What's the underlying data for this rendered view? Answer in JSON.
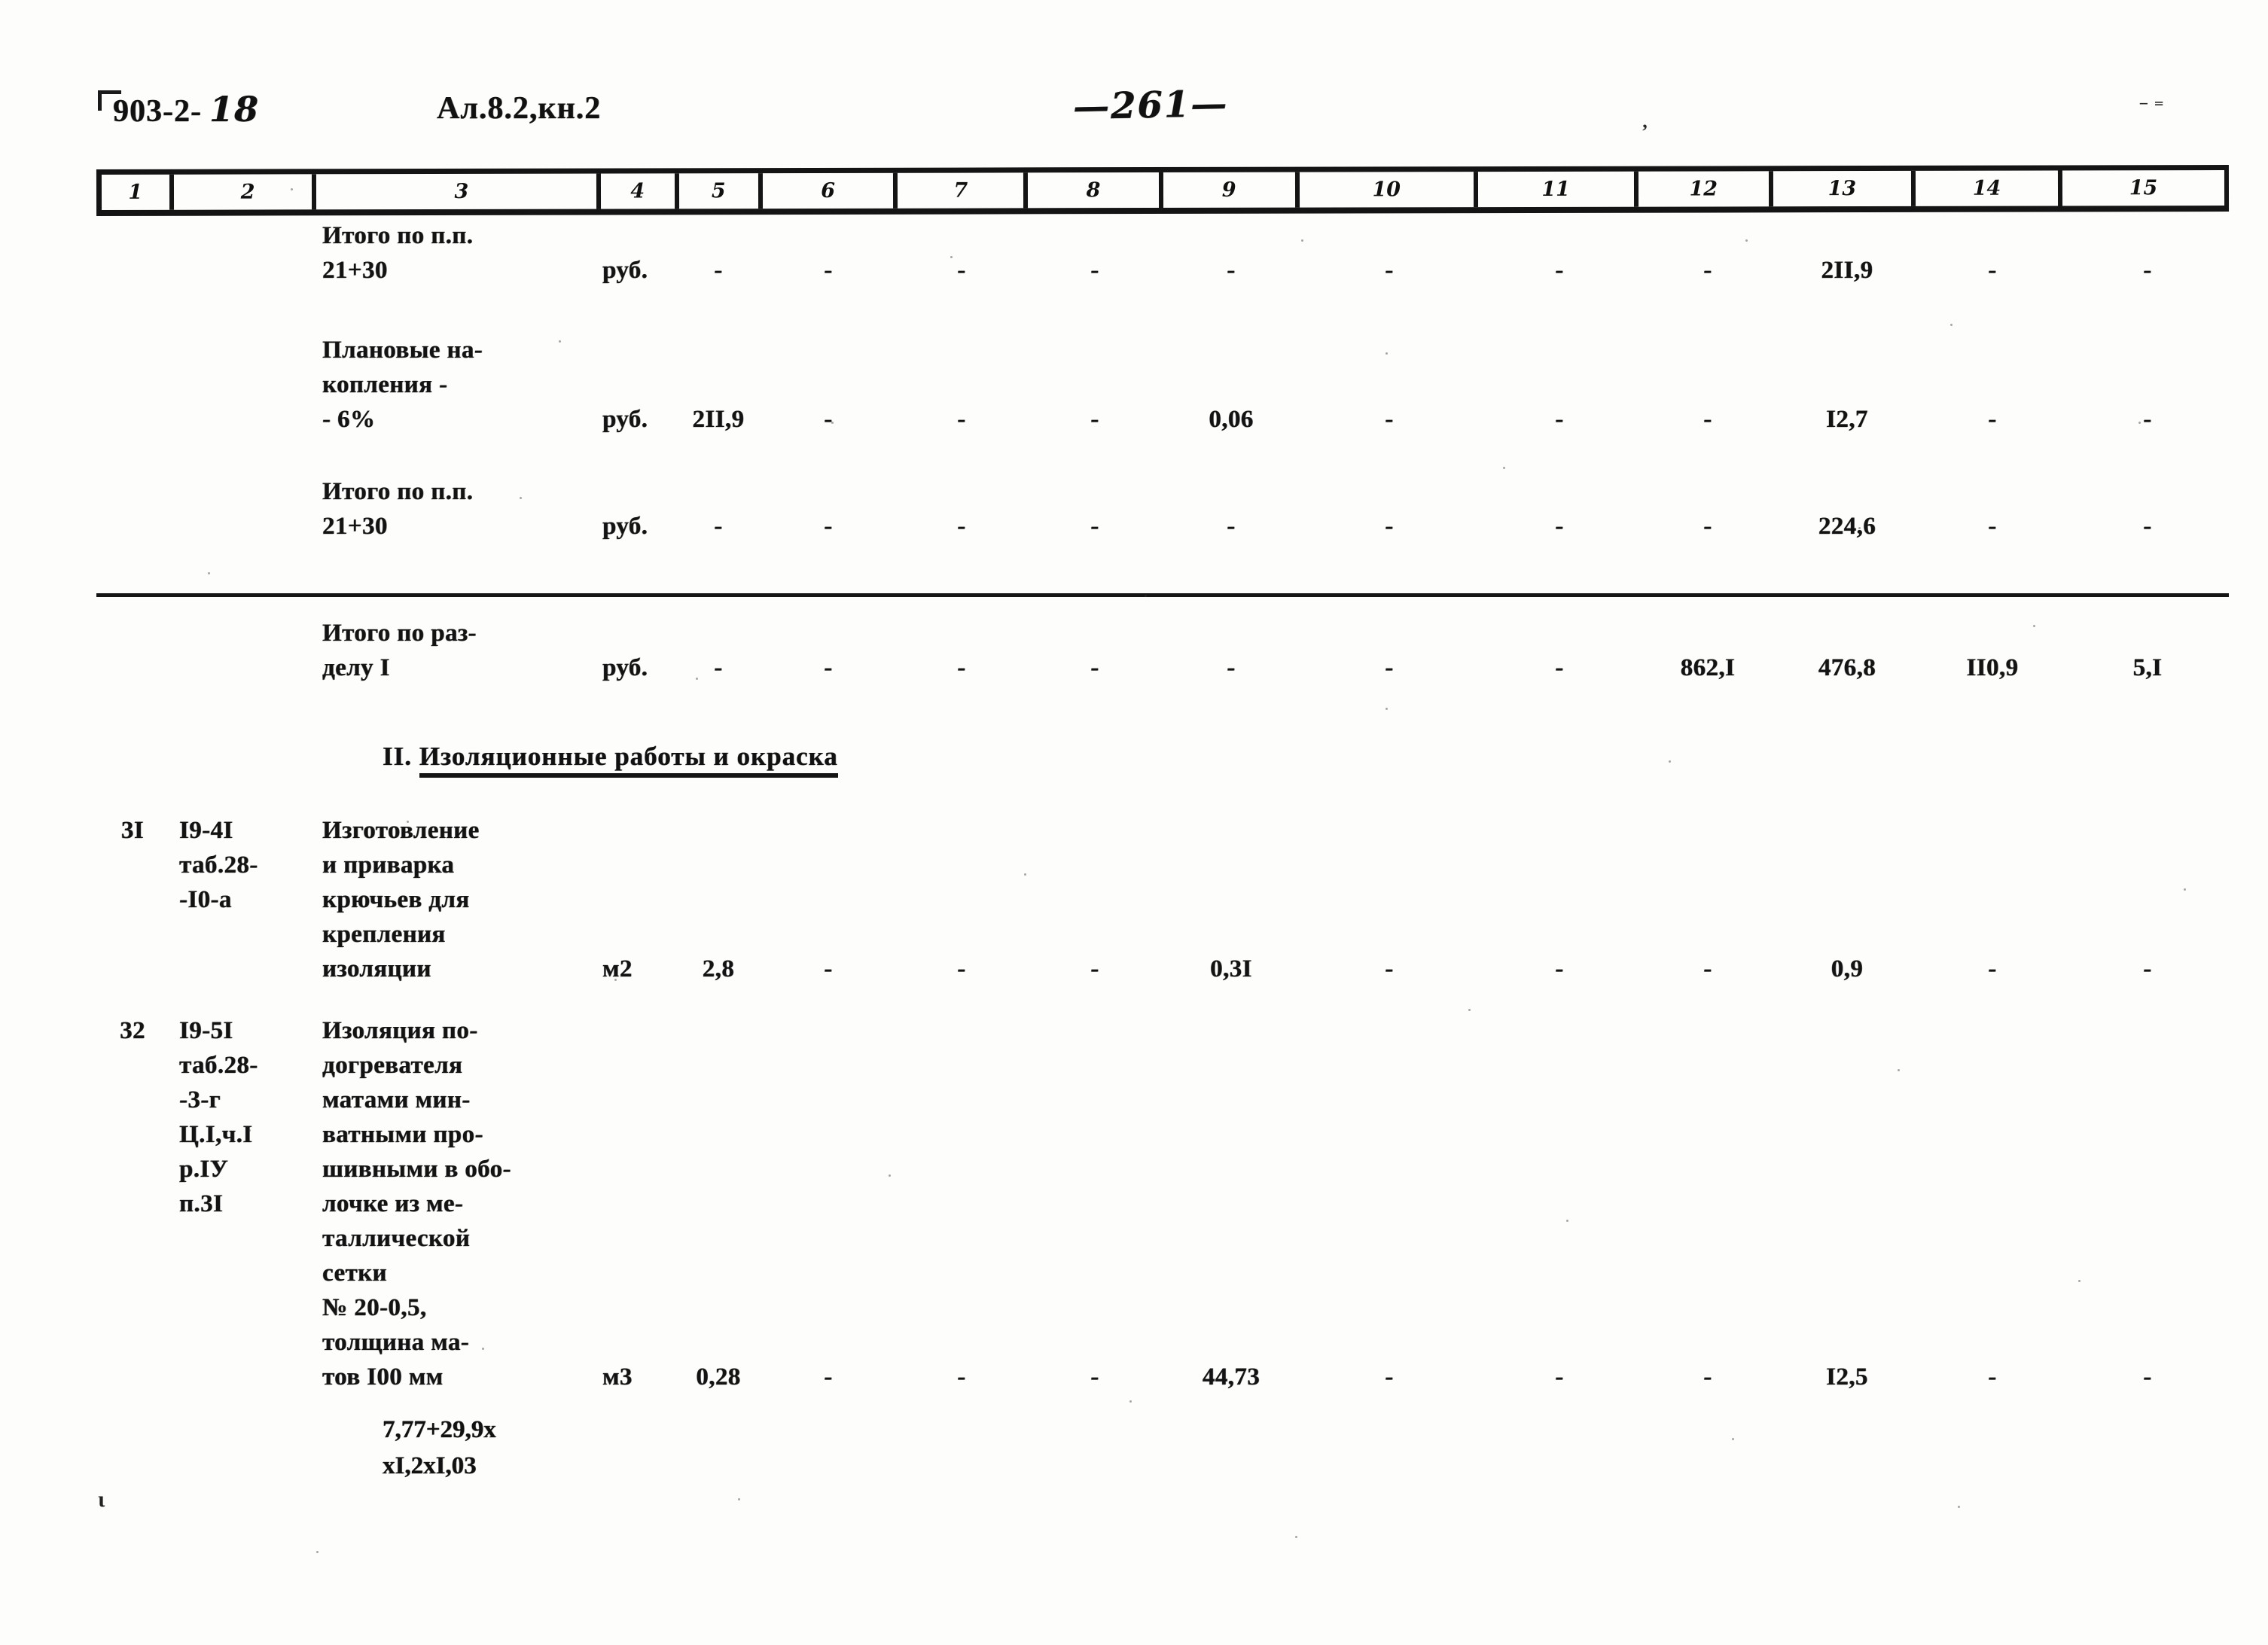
{
  "header": {
    "doc_code": "903-2-",
    "doc_code_variant": "18",
    "album_code": "Ал.8.2,кн.2",
    "page_number": "—261—"
  },
  "table": {
    "column_headers": [
      "1",
      "2",
      "3",
      "4",
      "5",
      "6",
      "7",
      "8",
      "9",
      "10",
      "11",
      "12",
      "13",
      "14",
      "15"
    ],
    "rows": [
      {
        "name": "total-items-21-30-first",
        "no": "",
        "ref": "",
        "desc": "Итого по п.п.\n21+30",
        "unit": "руб.",
        "c5": "-",
        "c6": "-",
        "c7": "-",
        "c8": "-",
        "c9": "-",
        "c10": "-",
        "c11": "-",
        "c12": "-",
        "c13": "2II,9",
        "c14": "-",
        "c15": "-"
      },
      {
        "name": "planned-accumulations",
        "no": "",
        "ref": "",
        "desc": "Плановые на-\nкопления -\n- 6%",
        "unit": "руб.",
        "c5": "2II,9",
        "c6": "-",
        "c7": "-",
        "c8": "-",
        "c9": "0,06",
        "c10": "-",
        "c11": "-",
        "c12": "-",
        "c13": "I2,7",
        "c14": "-",
        "c15": "-"
      },
      {
        "name": "total-items-21-30-second",
        "no": "",
        "ref": "",
        "desc": "Итого по п.п.\n21+30",
        "unit": "руб.",
        "c5": "-",
        "c6": "-",
        "c7": "-",
        "c8": "-",
        "c9": "-",
        "c10": "-",
        "c11": "-",
        "c12": "-",
        "c13": "224,6",
        "c14": "-",
        "c15": "-"
      },
      {
        "name": "total-section-one",
        "no": "",
        "ref": "",
        "desc": "Итого по раз-\nделу I",
        "unit": "руб.",
        "c5": "-",
        "c6": "-",
        "c7": "-",
        "c8": "-",
        "c9": "-",
        "c10": "-",
        "c11": "-",
        "c12": "862,I",
        "c13": "476,8",
        "c14": "II0,9",
        "c15": "5,I"
      },
      {
        "name": "item-31-hooks",
        "no": "3I",
        "ref": "I9-4I\nтаб.28-\n-I0-а",
        "desc": "Изготовление\nи приварка\nкрючьев для\nкрепления\nизоляции",
        "unit": "м2",
        "c5": "2,8",
        "c6": "-",
        "c7": "-",
        "c8": "-",
        "c9": "0,3I",
        "c10": "-",
        "c11": "-",
        "c12": "-",
        "c13": "0,9",
        "c14": "-",
        "c15": "-"
      },
      {
        "name": "item-32-insulation",
        "no": "32",
        "ref": "I9-5I\nтаб.28-\n-3-г\nЦ.I,ч.I\nр.IУ\nп.3I",
        "desc": "Изоляция по-\nдогревателя\nматами мин-\nватными про-\nшивными в обо-\nлочке из ме-\nталлической\nсетки\n№ 20-0,5,\nтолщина ма-\nтов I00 мм",
        "unit": "м3",
        "c5": "0,28",
        "c6": "-",
        "c7": "-",
        "c8": "-",
        "c9": "44,73",
        "c10": "-",
        "c11": "-",
        "c12": "-",
        "c13": "I2,5",
        "c14": "-",
        "c15": "-"
      }
    ]
  },
  "section_heading": {
    "prefix": "II.",
    "title": "Изоляционные работы и окраска"
  },
  "formula_note": "7,77+29,9х\nхI,2хI,03",
  "stray_marks": {
    "bottom_left": "ι"
  }
}
